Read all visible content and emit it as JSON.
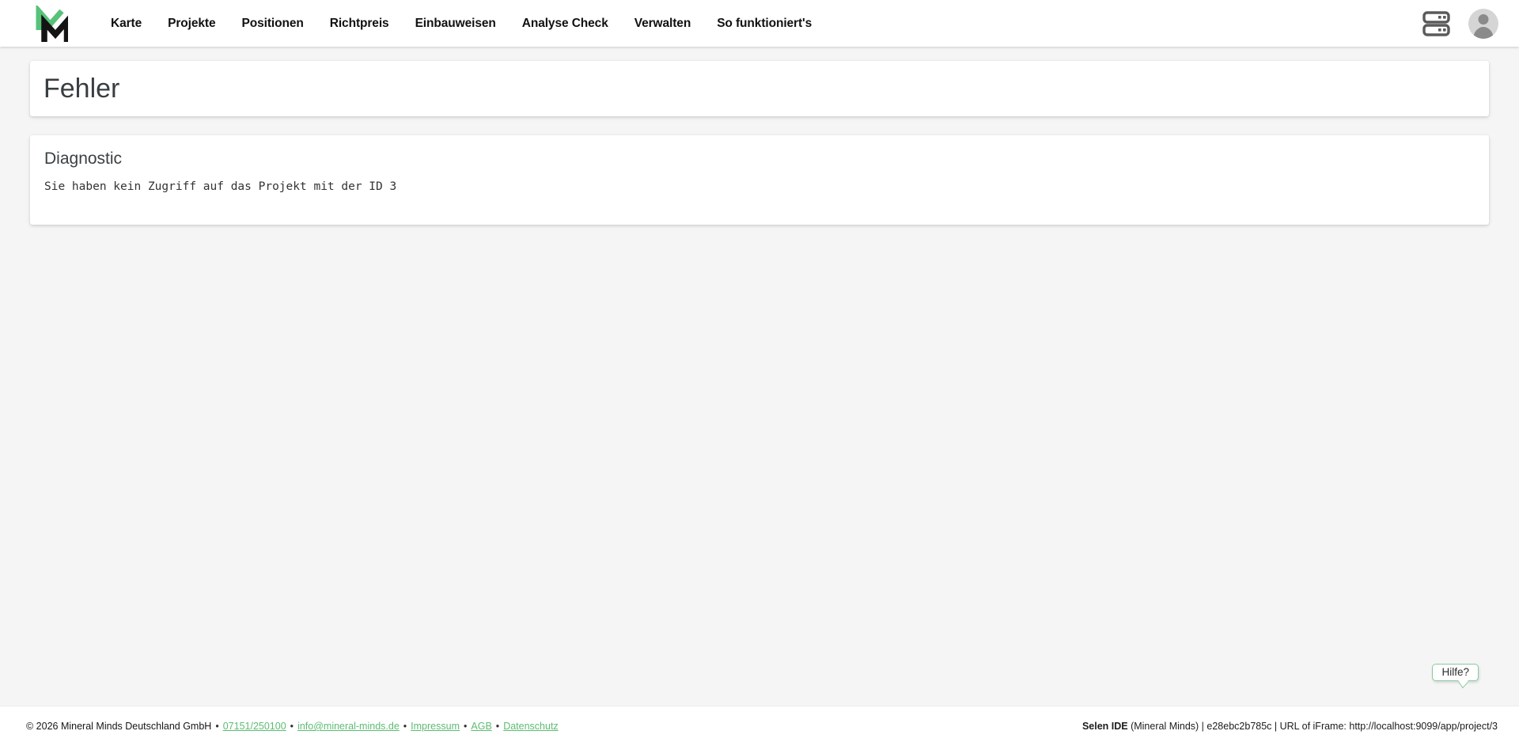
{
  "brand": {
    "logo_name": "mineral-minds-logo",
    "logo_green": "#57c278",
    "logo_black": "#141414"
  },
  "nav": {
    "items": [
      "Karte",
      "Projekte",
      "Positionen",
      "Richtpreis",
      "Einbauweisen",
      "Analyse Check",
      "Verwalten",
      "So funktioniert's"
    ],
    "icons": [
      "server-icon",
      "user-avatar-icon"
    ]
  },
  "error_panel": {
    "title": "Fehler"
  },
  "diagnostic_panel": {
    "heading": "Diagnostic",
    "message": "Sie haben kein Zugriff auf das Projekt mit der ID 3"
  },
  "help_bubble": {
    "label": "Hilfe?",
    "border_color": "#86cb9b"
  },
  "footer": {
    "copyright": "© 2026 Mineral Minds Deutschland GmbH",
    "separator": "•",
    "links": {
      "phone": "07151/250100",
      "email": "info@mineral-minds.de",
      "impressum": "Impressum",
      "agb": "AGB",
      "datenschutz": "Datenschutz"
    },
    "link_color": "#5cbc72",
    "system_info": {
      "app": "Selen IDE",
      "rest": " (Mineral Minds) | e28ebc2b785c | URL of iFrame: http://localhost:9099/app/project/3"
    }
  }
}
